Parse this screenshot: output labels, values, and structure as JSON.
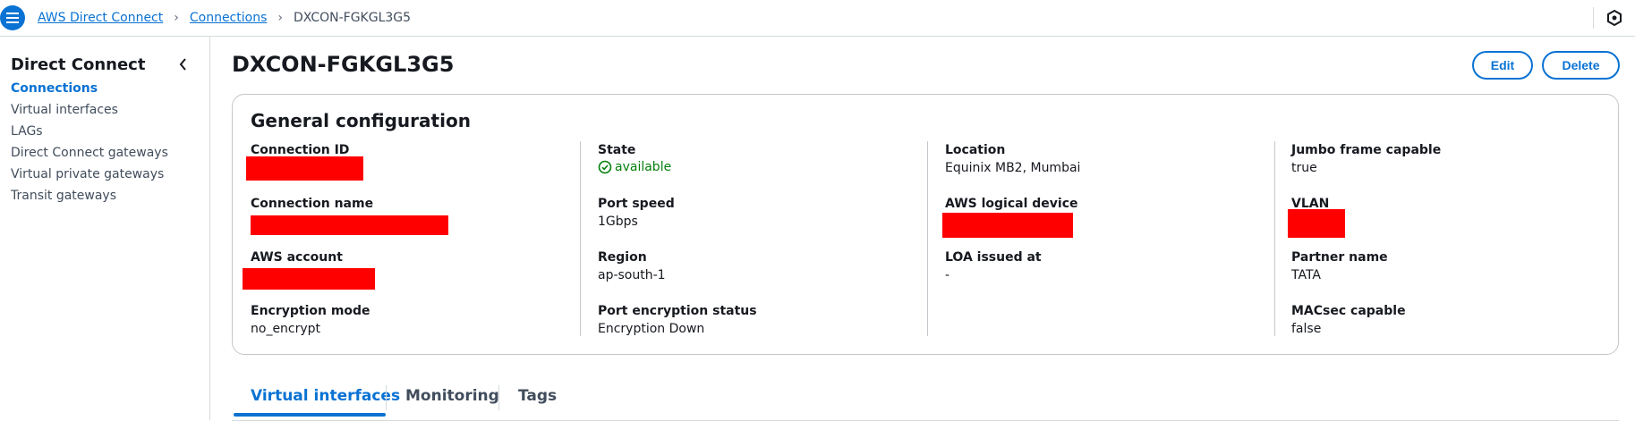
{
  "breadcrumbs": [
    "AWS Direct Connect",
    "Connections",
    "DXCON-FGKGL3G5"
  ],
  "sidebar": {
    "title": "Direct Connect",
    "items": [
      {
        "label": "Connections",
        "active": true
      },
      {
        "label": "Virtual interfaces"
      },
      {
        "label": "LAGs"
      },
      {
        "label": "Direct Connect gateways"
      },
      {
        "label": "Virtual private gateways"
      },
      {
        "label": "Transit gateways"
      }
    ]
  },
  "page": {
    "title": "DXCON-FGKGL3G5",
    "edit_label": "Edit",
    "delete_label": "Delete"
  },
  "general": {
    "title": "General configuration",
    "connection_id_label": "Connection ID",
    "connection_name_label": "Connection name",
    "aws_account_label": "AWS account",
    "encryption_mode_label": "Encryption mode",
    "encryption_mode_value": "no_encrypt",
    "state_label": "State",
    "state_value": "available",
    "port_speed_label": "Port speed",
    "port_speed_value": "1Gbps",
    "region_label": "Region",
    "region_value": "ap-south-1",
    "port_encryption_label": "Port encryption status",
    "port_encryption_value": "Encryption Down",
    "location_label": "Location",
    "location_value": "Equinix MB2, Mumbai",
    "logical_device_label": "AWS logical device",
    "loa_label": "LOA issued at",
    "loa_value": "-",
    "jumbo_label": "Jumbo frame capable",
    "jumbo_value": "true",
    "vlan_label": "VLAN",
    "partner_label": "Partner name",
    "partner_value": "TATA",
    "macsec_label": "MACsec capable",
    "macsec_value": "false"
  },
  "tabs": [
    "Virtual interfaces",
    "Monitoring",
    "Tags"
  ],
  "colors": {
    "accent": "#0972d3",
    "success": "#037f0c",
    "redaction": "#ff0000"
  }
}
